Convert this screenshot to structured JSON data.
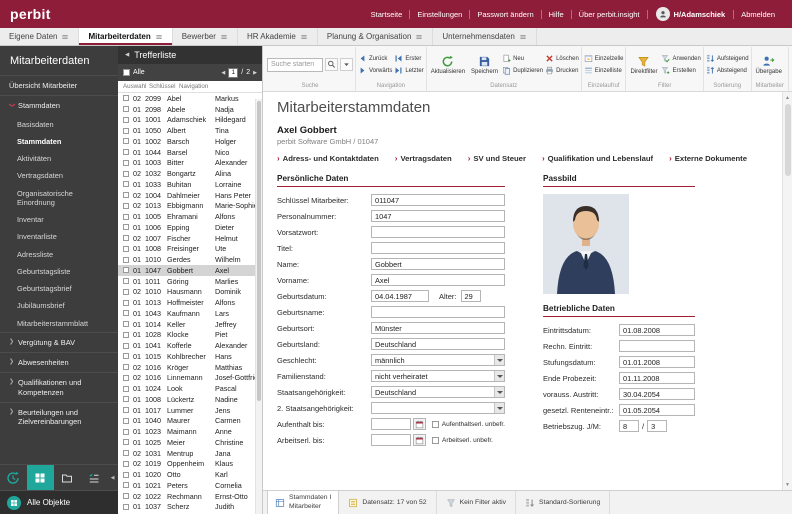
{
  "colors": {
    "brand_red": "#8e1d39",
    "accent_teal": "#1fa79b"
  },
  "header": {
    "logo": "perbit",
    "links": [
      "Startseite",
      "Einstellungen",
      "Passwort ändern",
      "Hilfe",
      "Über perbit.insight"
    ],
    "user": "H/Adamschiek",
    "logout": "Abmelden"
  },
  "nav": {
    "tabs": [
      {
        "label": "Eigene Daten",
        "active": false
      },
      {
        "label": "Mitarbeiterdaten",
        "active": true
      },
      {
        "label": "Bewerber",
        "active": false
      },
      {
        "label": "HR Akademie",
        "active": false
      },
      {
        "label": "Planung & Organisation",
        "active": false
      },
      {
        "label": "Unternehmensdaten",
        "active": false
      }
    ]
  },
  "sidebar": {
    "title": "Mitarbeiterdaten",
    "items": [
      {
        "label": "Übersicht Mitarbeiter",
        "type": "top"
      },
      {
        "label": "Stammdaten",
        "type": "section-open"
      },
      {
        "label": "Basisdaten",
        "type": "sub"
      },
      {
        "label": "Stammdaten",
        "type": "sub",
        "active": true
      },
      {
        "label": "Aktivitäten",
        "type": "sub"
      },
      {
        "label": "Vertragsdaten",
        "type": "sub"
      },
      {
        "label": "Organisatorische Einordnung",
        "type": "sub"
      },
      {
        "label": "Inventar",
        "type": "sub"
      },
      {
        "label": "Inventarliste",
        "type": "sub"
      },
      {
        "label": "Adressliste",
        "type": "sub"
      },
      {
        "label": "Geburtstagsliste",
        "type": "sub"
      },
      {
        "label": "Geburtstagsbrief",
        "type": "sub"
      },
      {
        "label": "Jubiläumsbrief",
        "type": "sub"
      },
      {
        "label": "Mitarbeiterstammblatt",
        "type": "sub"
      },
      {
        "label": "Vergütung & BAV",
        "type": "section"
      },
      {
        "label": "Abwesenheiten",
        "type": "section"
      },
      {
        "label": "Qualifikationen und Kompetenzen",
        "type": "section"
      },
      {
        "label": "Beurteilungen und Zielvereinbarungen",
        "type": "section"
      }
    ],
    "all_objects": "Alle Objekte"
  },
  "trefferliste": {
    "title": "Trefferliste",
    "all_label": "Alle",
    "page": "1",
    "page_total": "2",
    "columns": [
      "Auswahl",
      "Schlüssel",
      "Navigation"
    ],
    "selected_index": 16,
    "rows": [
      [
        "02",
        "2099",
        "Abel",
        "Markus"
      ],
      [
        "01",
        "2098",
        "Abele",
        "Nadja"
      ],
      [
        "01",
        "1001",
        "Adamschiek",
        "Hildegard"
      ],
      [
        "01",
        "1050",
        "Albert",
        "Tina"
      ],
      [
        "01",
        "1002",
        "Barsch",
        "Holger"
      ],
      [
        "01",
        "1044",
        "Barsel",
        "Nico"
      ],
      [
        "01",
        "1003",
        "Bitter",
        "Alexander"
      ],
      [
        "02",
        "1032",
        "Bongartz",
        "Alina"
      ],
      [
        "01",
        "1033",
        "Buhitan",
        "Lorraine"
      ],
      [
        "02",
        "1004",
        "Dahlmeier",
        "Hans Peter"
      ],
      [
        "02",
        "1013",
        "Ebbigmann",
        "Marie-Sophie"
      ],
      [
        "01",
        "1005",
        "Ehramani",
        "Alfons"
      ],
      [
        "01",
        "1006",
        "Epping",
        "Dieter"
      ],
      [
        "02",
        "1007",
        "Fischer",
        "Helmut"
      ],
      [
        "01",
        "1008",
        "Freisinger",
        "Ute"
      ],
      [
        "01",
        "1010",
        "Gerdes",
        "Wilhelm"
      ],
      [
        "01",
        "1047",
        "Gobbert",
        "Axel"
      ],
      [
        "01",
        "1011",
        "Göring",
        "Marlies"
      ],
      [
        "02",
        "1010",
        "Hausmann",
        "Dominik"
      ],
      [
        "01",
        "1013",
        "Hoffmeister",
        "Alfons"
      ],
      [
        "01",
        "1043",
        "Kaufmann",
        "Lars"
      ],
      [
        "01",
        "1014",
        "Keller",
        "Jeffrey"
      ],
      [
        "01",
        "1028",
        "Klocke",
        "Piet"
      ],
      [
        "01",
        "1041",
        "Kofferle",
        "Alexander"
      ],
      [
        "01",
        "1015",
        "Kohlbrecher",
        "Hans"
      ],
      [
        "02",
        "1016",
        "Kröger",
        "Matthias"
      ],
      [
        "02",
        "1016",
        "Linnemann",
        "Josef-Gottfried"
      ],
      [
        "01",
        "1024",
        "Look",
        "Pascal"
      ],
      [
        "01",
        "1008",
        "Lückertz",
        "Nadine"
      ],
      [
        "01",
        "1017",
        "Lummer",
        "Jens"
      ],
      [
        "01",
        "1040",
        "Maurer",
        "Carmen"
      ],
      [
        "01",
        "1023",
        "Maimann",
        "Anne"
      ],
      [
        "01",
        "1025",
        "Meier",
        "Christine"
      ],
      [
        "02",
        "1031",
        "Mentrup",
        "Jana"
      ],
      [
        "02",
        "1019",
        "Oppenheim",
        "Klaus"
      ],
      [
        "01",
        "1020",
        "Otto",
        "Karl"
      ],
      [
        "01",
        "1021",
        "Peters",
        "Cornelia"
      ],
      [
        "02",
        "1022",
        "Rechmann",
        "Ernst-Otto"
      ],
      [
        "01",
        "1037",
        "Scherz",
        "Judith"
      ]
    ]
  },
  "toolbar": {
    "groups": [
      {
        "name": "Suche",
        "search": true,
        "placeholder": "Suche starten"
      },
      {
        "name": "Navigation",
        "buttons": [
          {
            "label": "Zurück",
            "icon": "arrow-left",
            "size": "small"
          },
          {
            "label": "Vorwärts",
            "icon": "arrow-right",
            "size": "small"
          },
          {
            "label": "Erster",
            "icon": "arrow-first",
            "size": "small"
          },
          {
            "label": "Letzter",
            "icon": "arrow-last",
            "size": "small"
          }
        ]
      },
      {
        "name": "Datensatz",
        "buttons": [
          {
            "label": "Aktualisieren",
            "icon": "refresh",
            "size": "big"
          },
          {
            "label": "Speichern",
            "icon": "save",
            "size": "big"
          },
          {
            "label": "Neu",
            "icon": "new",
            "size": "small"
          },
          {
            "label": "Duplizieren",
            "icon": "duplicate",
            "size": "small"
          },
          {
            "label": "Löschen",
            "icon": "delete",
            "size": "small"
          },
          {
            "label": "Drucken",
            "icon": "print",
            "size": "small"
          }
        ]
      },
      {
        "name": "Einzelaufruf",
        "buttons": [
          {
            "label": "Einzelzelle",
            "icon": "single-cell",
            "size": "small"
          },
          {
            "label": "Einzelliste",
            "icon": "single-list",
            "size": "small"
          }
        ]
      },
      {
        "name": "Filter",
        "buttons": [
          {
            "label": "Direktfilter",
            "icon": "filter",
            "size": "big"
          },
          {
            "label": "Anwenden",
            "icon": "filter-apply",
            "size": "small"
          },
          {
            "label": "Erstellen",
            "icon": "filter-new",
            "size": "small"
          }
        ]
      },
      {
        "name": "Sortierung",
        "buttons": [
          {
            "label": "Aufsteigend",
            "icon": "sort-asc",
            "size": "small"
          },
          {
            "label": "Absteigend",
            "icon": "sort-desc",
            "size": "small"
          }
        ]
      },
      {
        "name": "Mitarbeiter",
        "buttons": [
          {
            "label": "Übergabe",
            "icon": "handover",
            "size": "big"
          }
        ]
      }
    ]
  },
  "record": {
    "page_title": "Mitarbeiterstammdaten",
    "person_name": "Axel Gobbert",
    "person_sub": "perbit Software GmbH / 01047",
    "links": [
      "Adress- und Kontaktdaten",
      "Vertragsdaten",
      "SV und Steuer",
      "Qualifikation und Lebenslauf",
      "Externe Dokumente"
    ],
    "personal": {
      "title": "Persönliche Daten",
      "fields": [
        {
          "label": "Schlüssel Mitarbeiter:",
          "value": "011047"
        },
        {
          "label": "Personalnummer:",
          "value": "1047"
        },
        {
          "label": "Vorsatzwort:",
          "value": ""
        },
        {
          "label": "Titel:",
          "value": ""
        },
        {
          "label": "Name:",
          "value": "Gobbert"
        },
        {
          "label": "Vorname:",
          "value": "Axel"
        },
        {
          "label": "Geburtsdatum:",
          "value": "04.04.1987",
          "type": "text-extra",
          "extra_label": "Alter:",
          "extra_value": "29"
        },
        {
          "label": "Geburtsname:",
          "value": ""
        },
        {
          "label": "Geburtsort:",
          "value": "Münster"
        },
        {
          "label": "Geburtsland:",
          "value": "Deutschland"
        },
        {
          "label": "Geschlecht:",
          "value": "männlich",
          "type": "select"
        },
        {
          "label": "Familienstand:",
          "value": "nicht verheiratet",
          "type": "select"
        },
        {
          "label": "Staatsangehörigkeit:",
          "value": "Deutschland",
          "type": "select"
        },
        {
          "label": "2. Staatsangehörigkeit:",
          "value": "",
          "type": "select"
        },
        {
          "label": "Aufenthalt bis:",
          "value": "",
          "type": "date-check",
          "check_label": "Aufenthaltserl. unbefr."
        },
        {
          "label": "Arbeitserl. bis:",
          "value": "",
          "type": "date-check",
          "check_label": "Arbeitserl. unbefr."
        }
      ]
    },
    "passbild_title": "Passbild",
    "company": {
      "title": "Betriebliche Daten",
      "fields": [
        {
          "label": "Eintrittsdatum:",
          "value": "01.08.2008"
        },
        {
          "label": "Rechn. Eintritt:",
          "value": ""
        },
        {
          "label": "Stufungsdatum:",
          "value": "01.01.2008"
        },
        {
          "label": "Ende Probezeit:",
          "value": "01.11.2008"
        },
        {
          "label": "vorauss. Austritt:",
          "value": "30.04.2054"
        },
        {
          "label": "gesetzl. Renteneintr.:",
          "value": "01.05.2054"
        },
        {
          "label": "Betriebszug. J/M:",
          "value": "8",
          "value2": "3",
          "type": "dual",
          "separator": "/"
        }
      ]
    }
  },
  "statusbar": {
    "tab_line1": "Stammdaten I",
    "tab_line2": "Mitarbeiter",
    "record_info": "Datensatz: 17 von 52",
    "filter_info": "Kein Filter aktiv",
    "sort_info": "Standard-Sortierung"
  }
}
